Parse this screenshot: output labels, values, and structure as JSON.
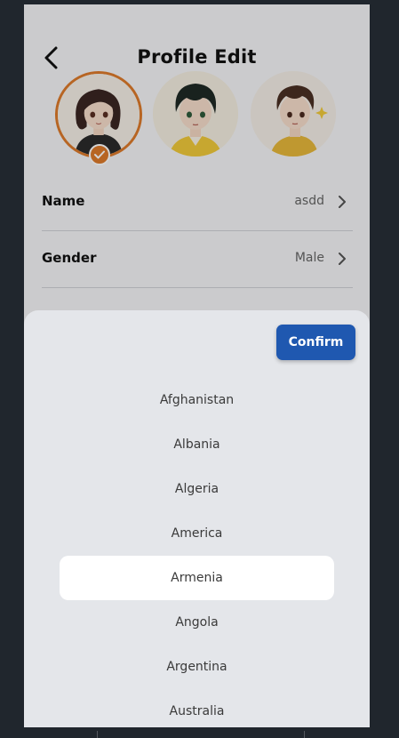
{
  "header": {
    "title": "Profile Edit"
  },
  "avatars": [
    {
      "name": "avatar-girl",
      "selected": true
    },
    {
      "name": "avatar-boy-green",
      "selected": false
    },
    {
      "name": "avatar-boy-brown",
      "selected": false
    }
  ],
  "fields": [
    {
      "label": "Name",
      "value": "asdd"
    },
    {
      "label": "Gender",
      "value": "Male"
    }
  ],
  "picker": {
    "confirm_label": "Confirm",
    "options": [
      "Afghanistan",
      "Albania",
      "Algeria",
      "America",
      "Armenia",
      "Angola",
      "Argentina",
      "Australia"
    ],
    "selected": "Armenia"
  },
  "colors": {
    "accent": "#dd7a2b",
    "primary": "#1f58b0"
  }
}
